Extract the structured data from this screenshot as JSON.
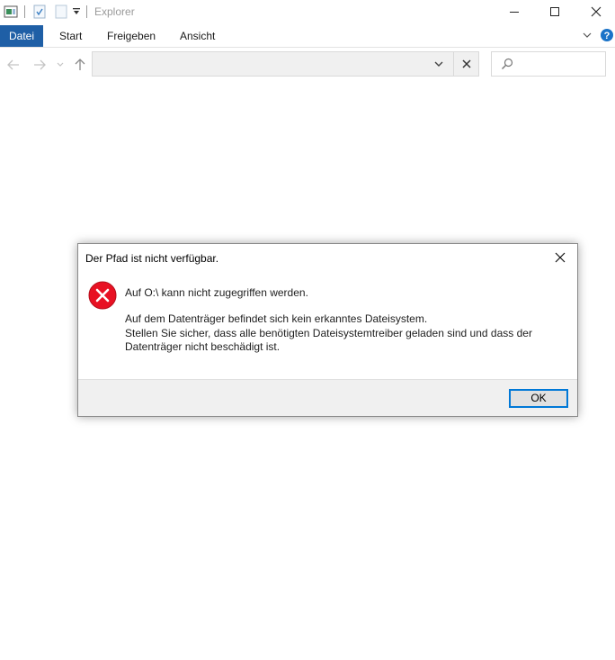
{
  "window": {
    "title": "Explorer"
  },
  "ribbon": {
    "tabs": [
      {
        "label": "Datei",
        "active": true
      },
      {
        "label": "Start"
      },
      {
        "label": "Freigeben"
      },
      {
        "label": "Ansicht"
      }
    ],
    "help_icon": "help-icon"
  },
  "address_bar": {
    "value": "",
    "search_placeholder": ""
  },
  "dialog": {
    "title": "Der Pfad ist nicht verfügbar.",
    "main_message": "Auf O:\\ kann nicht zugegriffen werden.",
    "detail_lines": [
      "Auf dem Datenträger befindet sich kein erkanntes Dateisystem.",
      "Stellen Sie sicher, dass alle benötigten Dateisystemtreiber geladen sind und dass der",
      "Datenträger nicht beschädigt ist."
    ],
    "ok_label": "OK",
    "icon": "error-icon"
  },
  "colors": {
    "file_tab": "#1f5fa6",
    "error_red": "#e81123",
    "focus_blue": "#0078d7",
    "help_blue": "#1a73c8"
  }
}
